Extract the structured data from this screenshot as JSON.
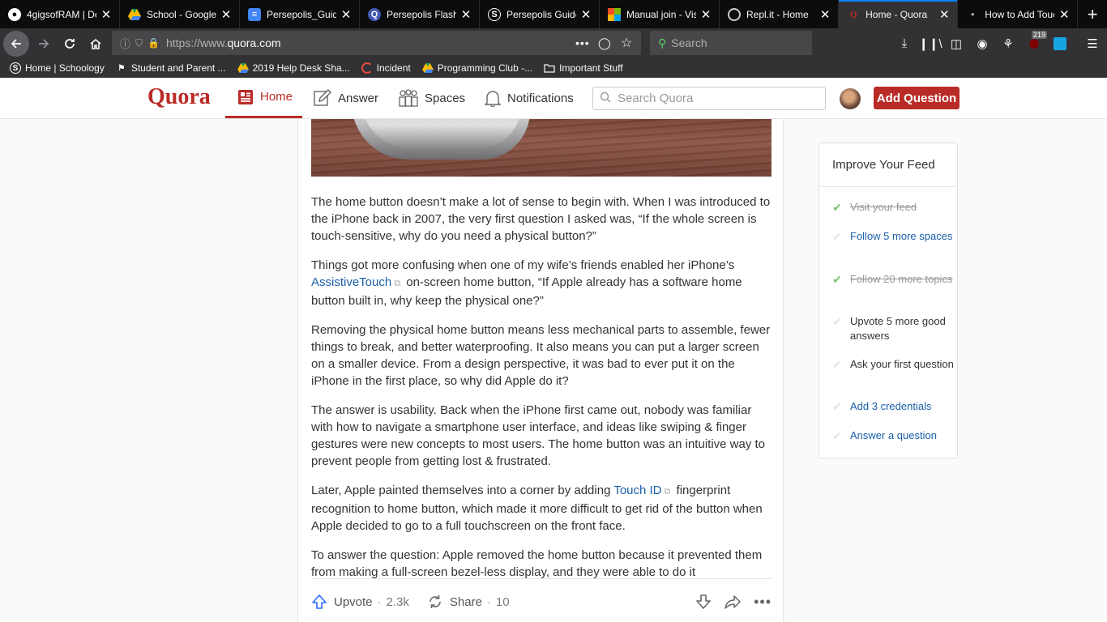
{
  "browser": {
    "tabs": [
      {
        "title": "4gigsofRAM | De",
        "favicon": "github-icon",
        "active": false
      },
      {
        "title": "School - Google",
        "favicon": "google-drive-icon",
        "active": false
      },
      {
        "title": "Persepolis_Guide",
        "favicon": "google-docs-icon",
        "active": false
      },
      {
        "title": "Persepolis Flash",
        "favicon": "quizlet-icon",
        "active": false
      },
      {
        "title": "Persepolis Guide",
        "favicon": "schoology-icon",
        "active": false
      },
      {
        "title": "Manual join - Vis",
        "favicon": "microsoft-icon",
        "active": false
      },
      {
        "title": "Repl.it - Home",
        "favicon": "replit-icon",
        "active": false
      },
      {
        "title": "Home - Quora",
        "favicon": "quora-icon",
        "active": true
      },
      {
        "title": "How to Add Touc",
        "favicon": "dot-icon",
        "active": false
      }
    ],
    "url_prefix": "https://www.",
    "url_domain": "quora.com",
    "search_placeholder": "Search",
    "notification_badge": "219",
    "bookmarks": [
      {
        "label": "Home | Schoology",
        "icon": "schoology-icon"
      },
      {
        "label": "Student and Parent ...",
        "icon": "flag-icon"
      },
      {
        "label": "2019 Help Desk Sha...",
        "icon": "google-drive-icon"
      },
      {
        "label": "Incident",
        "icon": "servicenow-icon"
      },
      {
        "label": "Programming Club -...",
        "icon": "google-drive-icon"
      },
      {
        "label": "Important Stuff",
        "icon": "folder-icon"
      }
    ]
  },
  "quora": {
    "logo": "Quora",
    "nav": {
      "home": "Home",
      "answer": "Answer",
      "spaces": "Spaces",
      "notifications": "Notifications"
    },
    "search_placeholder": "Search Quora",
    "add_question": "Add Question",
    "brand_color": "#b92b27"
  },
  "answer": {
    "p1": "The home button doesn’t make a lot of sense to begin with. When I was introduced to the iPhone back in 2007, the very first question I asked was, “If the whole screen is touch-sensitive, why do you need a physical button?”",
    "p2_before": "Things got more confusing when one of my wife’s friends enabled her iPhone’s ",
    "p2_link": "AssistiveTouch",
    "p2_after": " on-screen home button, “If Apple already has a software home button built in, why keep the physical one?”",
    "p3": "Removing the physical home button means less mechanical parts to assemble, fewer things to break, and better waterproofing. It also means you can put a larger screen on a smaller device. From a design perspective, it was bad to ever put it on the iPhone in the first place, so why did Apple do it?",
    "p4": "The answer is usability. Back when the iPhone first came out, nobody was familiar with how to navigate a smartphone user interface, and ideas like swiping & finger gestures were new concepts to most users. The home button was an intuitive way to prevent people from getting lost & frustrated.",
    "p5_before": "Later, Apple painted themselves into a corner by adding ",
    "p5_link": "Touch ID",
    "p5_after": " fingerprint recognition to home button, which made it more difficult to get rid of the button when Apple decided to go to a full touchscreen on the front face.",
    "p6": "To answer the question: Apple removed the home button because it prevented them from making a full-screen bezel-less display, and they were able to do it",
    "upvote_label": "Upvote",
    "upvote_count": "2.3k",
    "share_label": "Share",
    "share_count": "10"
  },
  "improve_feed": {
    "title": "Improve Your Feed",
    "items": [
      {
        "text": "Visit your feed",
        "state": "done"
      },
      {
        "text": "Follow 5 more spaces",
        "state": "link"
      },
      {
        "text": "Follow 20 more topics",
        "state": "done"
      },
      {
        "text": "Upvote 5 more good answers",
        "state": "plain"
      },
      {
        "text": "Ask your first question",
        "state": "plain"
      },
      {
        "text": "Add 3 credentials",
        "state": "link"
      },
      {
        "text": "Answer a question",
        "state": "link"
      }
    ]
  }
}
